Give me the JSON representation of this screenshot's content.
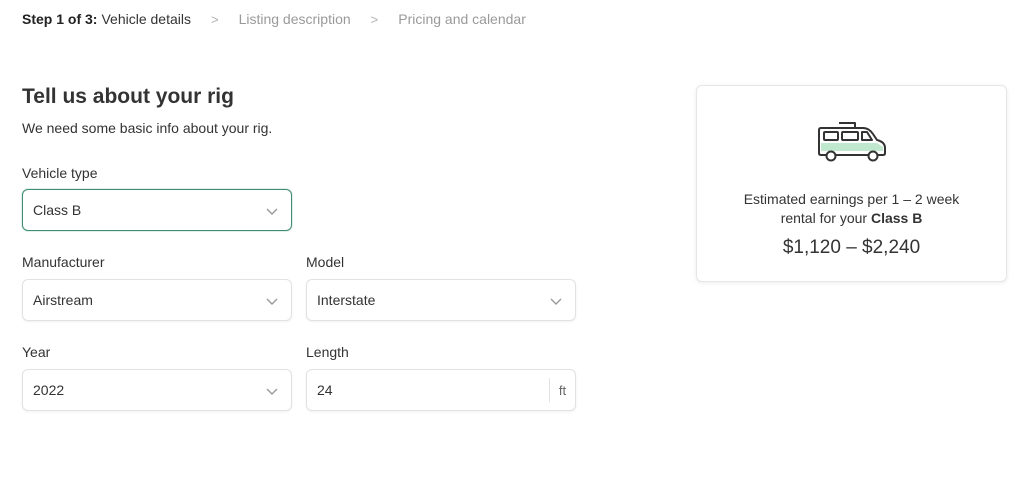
{
  "breadcrumb": {
    "step_prefix": "Step 1 of 3:",
    "current": "Vehicle details",
    "items": [
      "Listing description",
      "Pricing and calendar"
    ],
    "separator": ">"
  },
  "form": {
    "heading": "Tell us about your rig",
    "subheading": "We need some basic info about your rig.",
    "vehicle_type": {
      "label": "Vehicle type",
      "value": "Class B"
    },
    "manufacturer": {
      "label": "Manufacturer",
      "value": "Airstream"
    },
    "model": {
      "label": "Model",
      "value": "Interstate"
    },
    "year": {
      "label": "Year",
      "value": "2022"
    },
    "length": {
      "label": "Length",
      "value": "24",
      "unit": "ft"
    }
  },
  "earnings": {
    "text_line1": "Estimated earnings per 1 – 2 week",
    "text_line2_prefix": "rental for your",
    "vehicle_class": "Class B",
    "range": "$1,120 – $2,240",
    "icon": "van-icon",
    "accent_color": "#bfe8cf"
  },
  "colors": {
    "focus_border": "#3f8e6f",
    "muted_text": "#9a9a9a"
  }
}
